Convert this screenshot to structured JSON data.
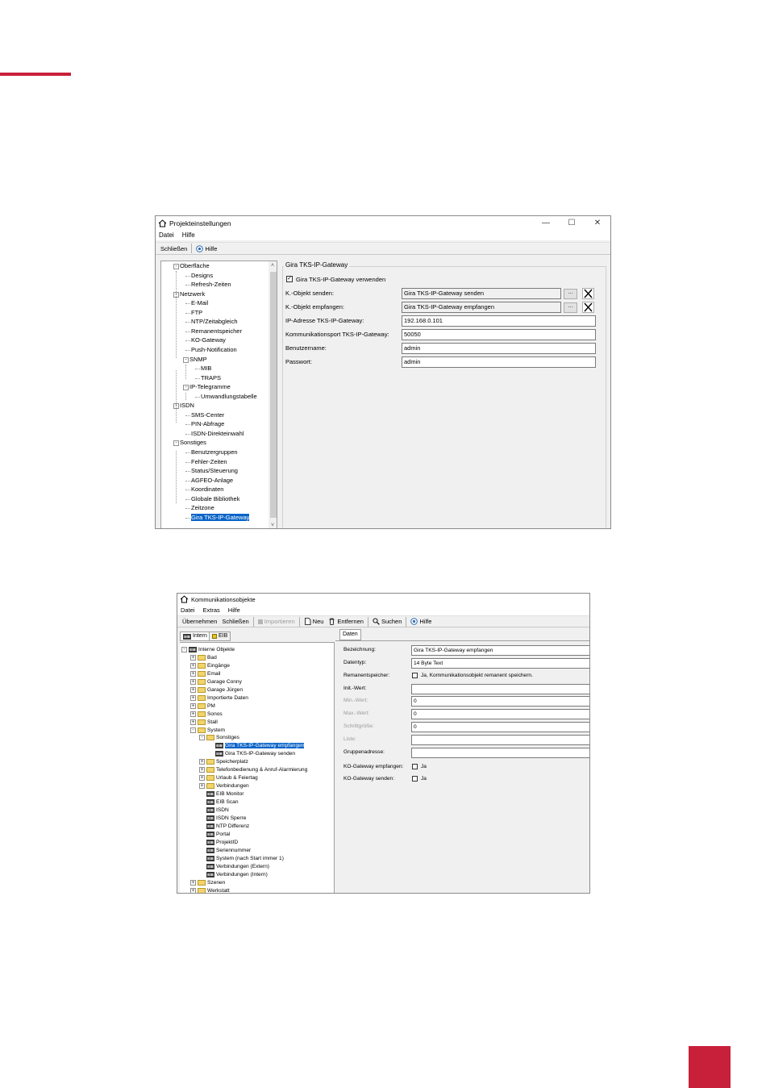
{
  "colors": {
    "accent": "#c8203a",
    "selection": "#0a64c8"
  },
  "win1": {
    "title": "Projekteinstellungen",
    "menu": [
      "Datei",
      "Hilfe"
    ],
    "toolbar": {
      "close": "Schließen",
      "help": "Hilfe"
    },
    "tree": [
      "Oberfläche",
      "Designs",
      "Refresh-Zeiten",
      "Netzwerk",
      "E-Mail",
      "FTP",
      "NTP/Zeitabgleich",
      "Remanentspeicher",
      "KO-Gateway",
      "Push-Notification",
      "SNMP",
      "MIB",
      "TRAPS",
      "IP-Telegramme",
      "Umwandlungstabelle",
      "ISDN",
      "SMS-Center",
      "PIN-Abfrage",
      "ISDN-Direkteinwahl",
      "Sonstiges",
      "Benutzergruppen",
      "Fehler-Zeiten",
      "Status/Steuerung",
      "AGFEO-Anlage",
      "Koordinaten",
      "Globale Bibliothek",
      "Zeitzone",
      "Gira TKS-IP-Gateway"
    ],
    "group_title": "Gira TKS-IP-Gateway",
    "use_checkbox": "Gira TKS-IP-Gateway verwenden",
    "fields": [
      {
        "label": "K.-Objekt senden:",
        "value": "Gira TKS-IP-Gateway senden"
      },
      {
        "label": "K.-Objekt empfangen:",
        "value": "Gira TKS-IP-Gateway empfangen"
      },
      {
        "label": "IP-Adresse TKS-IP-Gateway:",
        "value": "192.168.0.101"
      },
      {
        "label": "Kommunikationsport TKS-IP-Gateway:",
        "value": "50050"
      },
      {
        "label": "Benutzername:",
        "value": "admin"
      },
      {
        "label": "Passwort:",
        "value": "admin"
      }
    ],
    "browse": "..."
  },
  "win2": {
    "title": "Kommunikationsobjekte",
    "menu": [
      "Datei",
      "Extras",
      "Hilfe"
    ],
    "toolbar": {
      "apply": "Übernehmen",
      "close": "Schließen",
      "import": "Importieren",
      "new": "Neu",
      "remove": "Entfernen",
      "search": "Suchen",
      "help": "Hilfe"
    },
    "left_tabs": [
      "Intern",
      "EIB"
    ],
    "right_tab": "Daten",
    "tree": [
      "Interne Objekte",
      "Bad",
      "Eingänge",
      "Email",
      "Garage Conny",
      "Garage Jürgen",
      "Importierte Daten",
      "PM",
      "Sonos",
      "Stall",
      "System",
      "Sonstiges",
      "Gira TKS-IP-Gateway empfangen",
      "Gira TKS-IP-Gateway senden",
      "Speicherplatz",
      "Telefonbedienung & Anruf-Alarmierung",
      "Urlaub & Feiertag",
      "Verbindungen",
      "EIB Monitor",
      "EIB Scan",
      "ISDN",
      "ISDN Sperre",
      "NTP Differenz",
      "Portal",
      "ProjektID",
      "Seriennummer",
      "System (nach Start immer 1)",
      "Verbindungen (Extern)",
      "Verbindungen (Intern)",
      "Szenen",
      "Werkstatt"
    ],
    "obj_icon": "EIB",
    "form": {
      "name_label": "Bezeichnung:",
      "name_value": "Gira TKS-IP-Gateway empfangen",
      "type_label": "Datentyp:",
      "type_value": "14 Byte Text",
      "rem_label": "Remanentspeicher:",
      "rem_value": "Ja, Kommunikationsobjekt remanent speichern.",
      "init_label": "Init.-Wert:",
      "init_value": "",
      "min_label": "Min.-Wert:",
      "min_value": "0",
      "max_label": "Max.-Wert:",
      "max_value": "0",
      "step_label": "Schrittgröße:",
      "step_value": "0",
      "list_label": "Liste:",
      "list_value": "",
      "group_label": "Gruppenadresse:",
      "group_value": "",
      "gw_recv_label": "KO-Gateway empfangen:",
      "gw_recv_value": "Ja",
      "gw_send_label": "KO-Gateway senden:",
      "gw_send_value": "Ja"
    }
  }
}
